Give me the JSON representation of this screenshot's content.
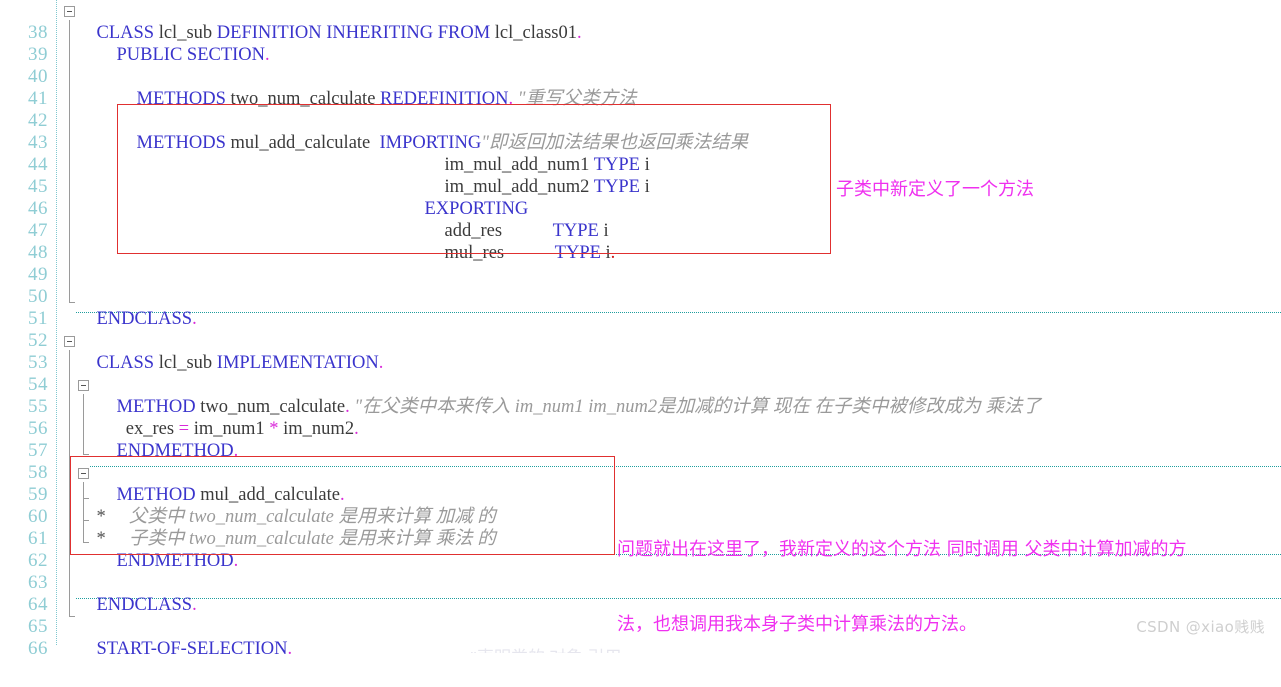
{
  "editor": {
    "language": "ABAP",
    "first_line": 38,
    "line_height": 22,
    "colors": {
      "background": "#ffffff",
      "keyword": "#3a34cc",
      "identifier": "#3b3b3b",
      "operator": "#d92ad9",
      "comment": "#9a9a9a",
      "line_number": "#8fcdd4",
      "annotation_box": "#e03030",
      "annotation_text": "#ef30ef",
      "separator": "#1f9e9e",
      "watermark": "#cfcfcf"
    }
  },
  "lines": [
    {
      "n": "38",
      "text": "CLASS lcl_sub DEFINITION INHERITING FROM lcl_class01."
    },
    {
      "n": "39",
      "text": "  PUBLIC SECTION."
    },
    {
      "n": "40",
      "text": ""
    },
    {
      "n": "41",
      "text": "    METHODS two_num_calculate REDEFINITION. \"重写父类方法"
    },
    {
      "n": "42",
      "text": ""
    },
    {
      "n": "43",
      "text": "    METHODS mul_add_calculate  IMPORTING\"即返回加法结果也返回乘法结果"
    },
    {
      "n": "44",
      "text": "                                 im_mul_add_num1 TYPE i"
    },
    {
      "n": "45",
      "text": "                                 im_mul_add_num2 TYPE i"
    },
    {
      "n": "46",
      "text": "                               EXPORTING"
    },
    {
      "n": "47",
      "text": "                                 add_res          TYPE i"
    },
    {
      "n": "48",
      "text": "                                 mul_res          TYPE i."
    },
    {
      "n": "49",
      "text": ""
    },
    {
      "n": "50",
      "text": ""
    },
    {
      "n": "51",
      "text": "ENDCLASS."
    },
    {
      "n": "52",
      "text": ""
    },
    {
      "n": "53",
      "text": "CLASS lcl_sub IMPLEMENTATION."
    },
    {
      "n": "54",
      "text": ""
    },
    {
      "n": "55",
      "text": "  METHOD two_num_calculate. \"在父类中本来传入 im_num1 im_num2是加减的计算 现在 在子类中被修改成为 乘法了"
    },
    {
      "n": "56",
      "text": "    ex_res = im_num1 * im_num2."
    },
    {
      "n": "57",
      "text": "  ENDMETHOD."
    },
    {
      "n": "58",
      "text": ""
    },
    {
      "n": "59",
      "text": "  METHOD mul_add_calculate."
    },
    {
      "n": "60",
      "text": "*     父类中 two_num_calculate 是用来计算 加减 的"
    },
    {
      "n": "61",
      "text": "*     子类中 two_num_calculate 是用来计算 乘法 的"
    },
    {
      "n": "62",
      "text": "  ENDMETHOD."
    },
    {
      "n": "63",
      "text": ""
    },
    {
      "n": "64",
      "text": "ENDCLASS."
    },
    {
      "n": "65",
      "text": ""
    },
    {
      "n": "66",
      "text": "  START-OF-SELECTION."
    }
  ],
  "tokens": {
    "l38": {
      "kw1": "CLASS",
      "id1": " lcl_sub ",
      "kw2": "DEFINITION INHERITING FROM",
      "id2": " lcl_class01",
      "dot": "."
    },
    "l39": {
      "kw": "PUBLIC SECTION",
      "dot": "."
    },
    "l41": {
      "kw1": "METHODS",
      "id1": " two_num_calculate ",
      "kw2": "REDEFINITION",
      "dot": ".",
      "comment": " \"重写父类方法"
    },
    "l43": {
      "kw1": "METHODS",
      "id1": " mul_add_calculate  ",
      "kw2": "IMPORTING",
      "comment": "\"即返回加法结果也返回乘法结果"
    },
    "l44": {
      "id": "im_mul_add_num1 ",
      "kw": "TYPE",
      "type": " i"
    },
    "l45": {
      "id": "im_mul_add_num2 ",
      "kw": "TYPE",
      "type": " i"
    },
    "l46": {
      "kw": "EXPORTING"
    },
    "l47": {
      "id": "add_res           ",
      "kw": "TYPE",
      "type": " i"
    },
    "l48": {
      "id": "mul_res           ",
      "kw": "TYPE",
      "type": " i",
      "dot": "."
    },
    "l51": {
      "kw": "ENDCLASS",
      "dot": "."
    },
    "l53": {
      "kw1": "CLASS",
      "id1": " lcl_sub ",
      "kw2": "IMPLEMENTATION",
      "dot": "."
    },
    "l55": {
      "kw": "METHOD",
      "id": " two_num_calculate",
      "dot": ".",
      "comment": " \"在父类中本来传入 im_num1 im_num2是加减的计算 现在 在子类中被修改成为 乘法了"
    },
    "l56": {
      "id1": "  ex_res ",
      "op1": "=",
      "id2": " im_num1 ",
      "op2": "*",
      "id3": " im_num2",
      "dot": "."
    },
    "l57": {
      "kw": "ENDMETHOD",
      "dot": "."
    },
    "l59": {
      "kw": "METHOD",
      "id": " mul_add_calculate",
      "dot": "."
    },
    "l60": {
      "star": "*",
      "comment": "     父类中 two_num_calculate 是用来计算 加减 的"
    },
    "l61": {
      "star": "*",
      "comment": "     子类中 two_num_calculate 是用来计算 乘法 的"
    },
    "l62": {
      "kw": "ENDMETHOD",
      "dot": "."
    },
    "l64": {
      "kw": "ENDCLASS",
      "dot": "."
    },
    "l66": {
      "kw": "START-OF-SELECTION",
      "dot": "."
    }
  },
  "annotations": [
    {
      "id": "note-new-method",
      "text": "子类中新定义了一个方法",
      "color": "#ef30ef"
    },
    {
      "id": "note-problem",
      "line1": "问题就出在这里了，我新定义的这个方法 同时调用 父类中计算加减的方",
      "line2": "法，也想调用我本身子类中计算乘法的方法。",
      "color": "#ef30ef"
    }
  ],
  "boxes": [
    {
      "id": "redbox-method-declaration",
      "label": "highlight around mul_add_calculate declaration"
    },
    {
      "id": "redbox-method-implementation",
      "label": "highlight around mul_add_calculate implementation"
    }
  ],
  "watermark": {
    "text": "CSDN @xiao贱贱"
  },
  "clipped_bottom": {
    "text": "\"声明类的 对象 引用"
  }
}
